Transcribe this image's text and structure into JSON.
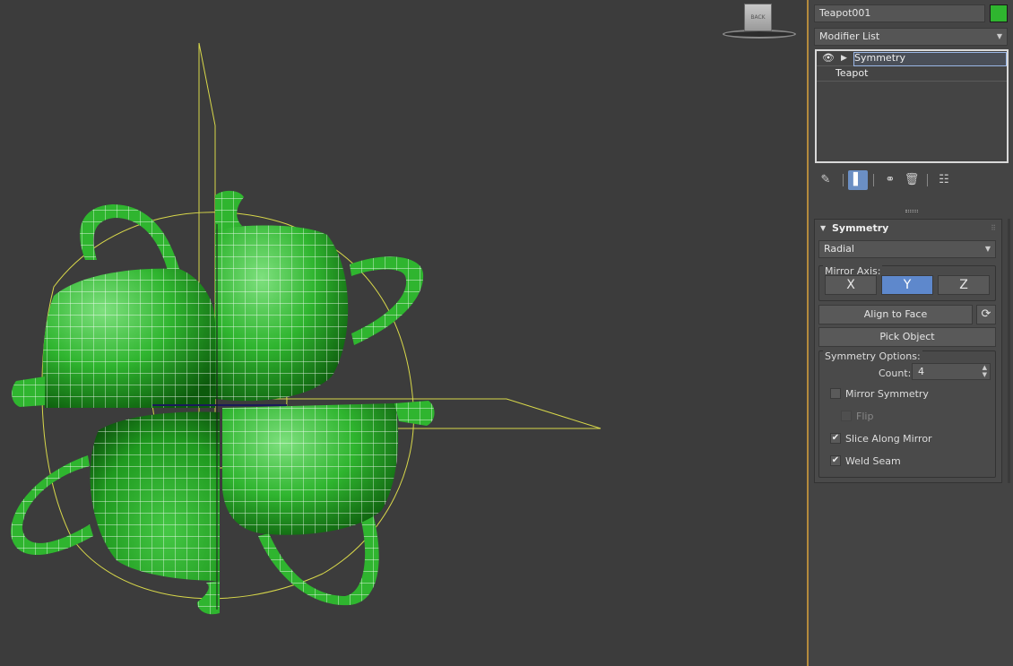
{
  "viewport": {
    "viewcube_label": "BACK",
    "object_color": "#2fb52f",
    "wire_color": "#ffffff",
    "gizmo_color": "#d8d84a"
  },
  "panel": {
    "object_name": "Teapot001",
    "object_color": "#2fb52f",
    "modifier_list_label": "Modifier List",
    "stack": [
      {
        "label": "Symmetry",
        "selected": true
      },
      {
        "label": "Teapot",
        "selected": false
      }
    ],
    "tools": [
      "pin-stack-icon",
      "show-end-result-icon",
      "make-unique-icon",
      "remove-modifier-icon",
      "configure-modifier-sets-icon"
    ]
  },
  "rollout": {
    "title": "Symmetry",
    "mode": "Radial",
    "mirror_axis_label": "Mirror Axis:",
    "axes": [
      {
        "label": "X",
        "active": false
      },
      {
        "label": "Y",
        "active": true
      },
      {
        "label": "Z",
        "active": false
      }
    ],
    "align_to_face": "Align to Face",
    "pick_object": "Pick Object",
    "options_label": "Symmetry Options:",
    "count_label": "Count:",
    "count_value": "4",
    "checks": [
      {
        "label": "Mirror Symmetry",
        "checked": false,
        "disabled": false
      },
      {
        "label": "Flip",
        "checked": false,
        "disabled": true
      },
      {
        "label": "Slice Along Mirror",
        "checked": true,
        "disabled": false
      },
      {
        "label": "Weld Seam",
        "checked": true,
        "disabled": false
      }
    ]
  }
}
